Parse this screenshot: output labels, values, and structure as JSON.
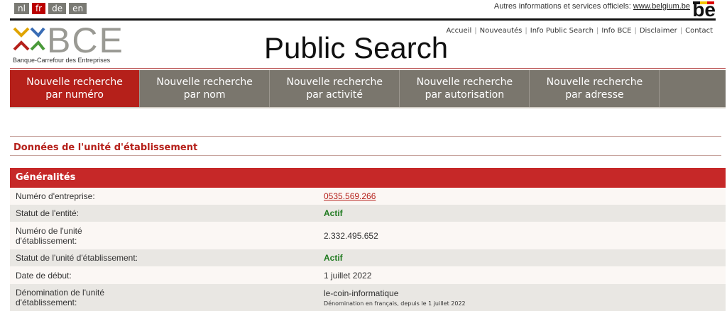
{
  "languages": [
    {
      "code": "nl",
      "active": false
    },
    {
      "code": "fr",
      "active": true
    },
    {
      "code": "de",
      "active": false
    },
    {
      "code": "en",
      "active": false
    }
  ],
  "belgium": {
    "text": "Autres informations et services officiels:",
    "link": "www.belgium.be",
    "logo": "be"
  },
  "header": {
    "logo_text": "BCE",
    "logo_subtitle": "Banque-Carrefour des Entreprises",
    "title": "Public Search",
    "links": [
      "Accueil",
      "Nouveautés",
      "Info Public Search",
      "Info BCE",
      "Disclaimer",
      "Contact"
    ]
  },
  "nav": [
    {
      "line1": "Nouvelle recherche",
      "line2": "par numéro",
      "active": true
    },
    {
      "line1": "Nouvelle recherche",
      "line2": "par nom",
      "active": false
    },
    {
      "line1": "Nouvelle recherche",
      "line2": "par activité",
      "active": false
    },
    {
      "line1": "Nouvelle recherche",
      "line2": "par autorisation",
      "active": false
    },
    {
      "line1": "Nouvelle recherche",
      "line2": "par adresse",
      "active": false
    }
  ],
  "section_title": "Données de l'unité d'établissement",
  "table": {
    "header": "Généralités",
    "rows": [
      {
        "label": "Numéro d'entreprise:",
        "value": "0535.569.266"
      },
      {
        "label": "Statut de l'entité:",
        "value": "Actif"
      },
      {
        "label": "Numéro de l'unité d'établissement:",
        "value": "2.332.495.652"
      },
      {
        "label": "Statut de l'unité d'établissement:",
        "value": "Actif"
      },
      {
        "label": "Date de début:",
        "value": "1 juillet 2022"
      },
      {
        "label": "Dénomination de l'unité d'établissement:",
        "value": "le-coin-informatique",
        "note": "Dénomination en français, depuis le 1 juillet 2022"
      }
    ]
  },
  "colors": {
    "accent": "#b5201a",
    "nav_bg": "#7a766d",
    "status_green": "#1f7a1f"
  }
}
